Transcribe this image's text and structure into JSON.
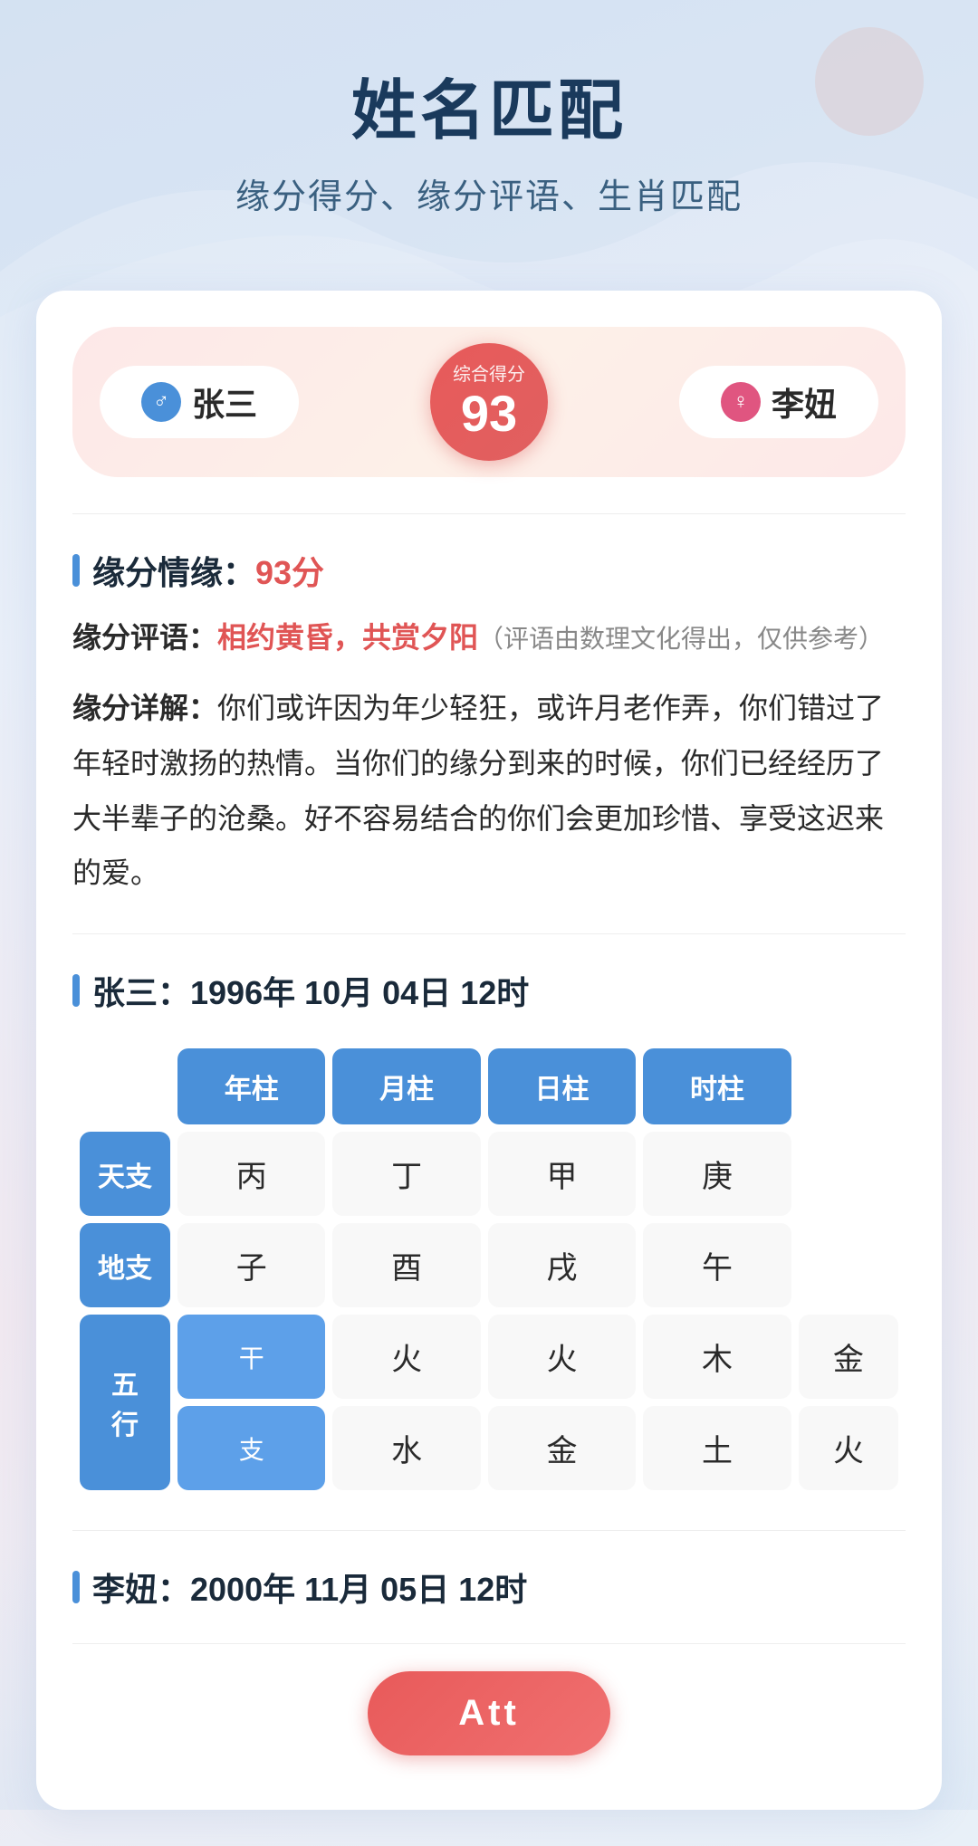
{
  "page": {
    "title": "姓名匹配",
    "subtitle": "缘分得分、缘分评语、生肖匹配"
  },
  "score_header": {
    "person1": {
      "name": "张三",
      "gender": "male",
      "icon": "♂"
    },
    "person2": {
      "name": "李妞",
      "gender": "female",
      "icon": "♀"
    },
    "score_label": "综合得分",
    "score_value": "93"
  },
  "yuanfen_section": {
    "title": "缘分情缘：",
    "score": "93分",
    "comment_label": "缘分评语：",
    "comment_highlight": "相约黄昏，共赏夕阳",
    "comment_note": "（评语由数理文化得出，仅供参考）",
    "detail_label": "缘分详解：",
    "detail_text": "你们或许因为年少轻狂，或许月老作弄，你们错过了年轻时激扬的热情。当你们的缘分到来的时候，你们已经经历了大半辈子的沧桑。好不容易结合的你们会更加珍惜、享受这迟来的爱。"
  },
  "person1_section": {
    "title_name": "张三：",
    "title_date": "1996年 10月 04日 12时",
    "table": {
      "headers": [
        "年柱",
        "月柱",
        "日柱",
        "时柱"
      ],
      "row_tiankan": {
        "label": "天支",
        "values": [
          "丙",
          "丁",
          "甲",
          "庚"
        ]
      },
      "row_dizhi": {
        "label": "地支",
        "values": [
          "子",
          "酉",
          "戌",
          "午"
        ]
      },
      "row_wuxing_gan": {
        "outer_label": "五",
        "inner_label": "干",
        "values": [
          "火",
          "火",
          "木",
          "金"
        ]
      },
      "row_wuxing_zhi": {
        "inner_label": "支",
        "values": [
          "水",
          "金",
          "土",
          "火"
        ]
      }
    }
  },
  "person2_section": {
    "title_name": "李妞：",
    "title_date": "2000年 11月 05日 12时"
  },
  "bottom": {
    "button_label": "Att"
  }
}
